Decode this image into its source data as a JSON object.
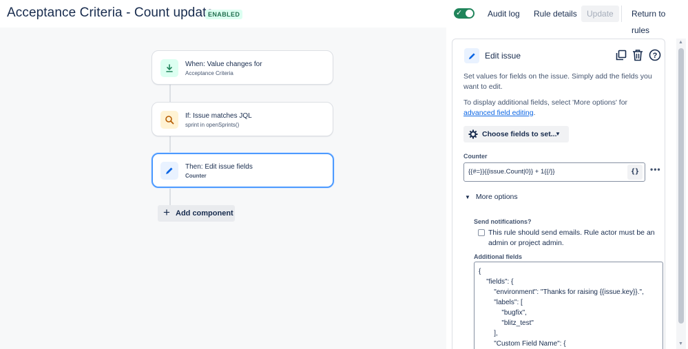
{
  "header": {
    "title": "Acceptance Criteria - Count update",
    "status_badge": "ENABLED",
    "audit_log": "Audit log",
    "rule_details": "Rule details",
    "update": "Update",
    "return_to_rules": "Return to rules"
  },
  "flow": {
    "trigger": {
      "title": "When: Value changes for",
      "subtitle": "Acceptance Criteria",
      "icon": "trigger-download-icon"
    },
    "condition": {
      "title": "If: Issue matches JQL",
      "subtitle": "sprint in openSprints()",
      "icon": "search-icon"
    },
    "action": {
      "title": "Then: Edit issue fields",
      "subtitle": "Counter",
      "icon": "pencil-icon"
    },
    "add_component": "Add component"
  },
  "panel": {
    "title": "Edit issue",
    "description": "Set values for fields on the issue. Simply add the fields you want to edit.",
    "display_hint_prefix": "To display additional fields, select 'More options' for ",
    "display_hint_link": "advanced field editing",
    "display_hint_suffix": ".",
    "choose_fields": "Choose fields to set...",
    "counter_label": "Counter",
    "counter_value": "{{#=}}{{issue.Count|0}} + 1{{/}}",
    "smart_value_button": "{}",
    "more_options": "More options",
    "send_notifications_label": "Send notifications?",
    "send_notifications_text": "This rule should send emails. Rule actor must be an admin or project admin.",
    "additional_fields_label": "Additional fields",
    "additional_fields_value": "{\n    \"fields\": {\n        \"environment\": \"Thanks for raising {{issue.key}}.\",\n        \"labels\": [\n            \"bugfix\",\n            \"blitz_test\"\n        ],\n        \"Custom Field Name\": {"
  },
  "colors": {
    "accent": "#0c66e4",
    "enabled_green": "#1f845a",
    "selected_border": "#4c9aff"
  }
}
